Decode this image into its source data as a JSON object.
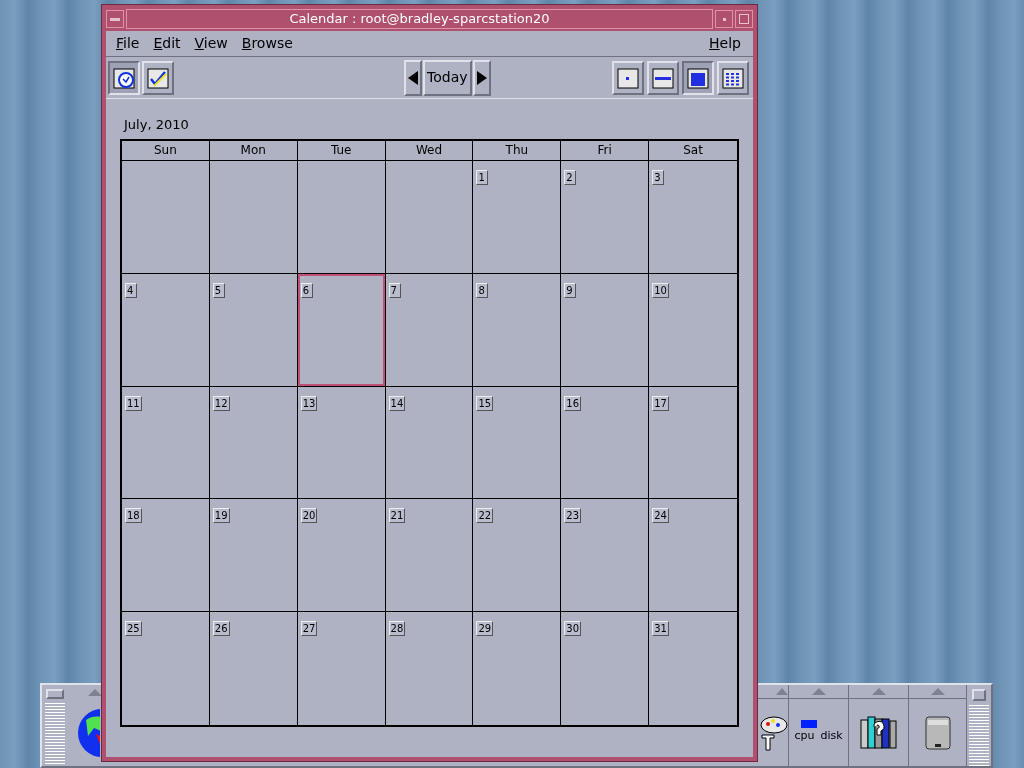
{
  "window": {
    "title": "Calendar : root@bradley-sparcstation20"
  },
  "menu": [
    {
      "label": "File"
    },
    {
      "label": "Edit"
    },
    {
      "label": "View"
    },
    {
      "label": "Browse"
    },
    {
      "label": "Help"
    }
  ],
  "toolbar": {
    "left": [
      {
        "kind": "appointment",
        "selected": true
      },
      {
        "kind": "todo",
        "selected": false
      }
    ],
    "today": "Today",
    "views": [
      {
        "kind": "day",
        "selected": false
      },
      {
        "kind": "week",
        "selected": false
      },
      {
        "kind": "month",
        "selected": true
      },
      {
        "kind": "year",
        "selected": false
      }
    ]
  },
  "calendar": {
    "month_label": "July, 2010",
    "weekdays": [
      "Sun",
      "Mon",
      "Tue",
      "Wed",
      "Thu",
      "Fri",
      "Sat"
    ],
    "weeks": [
      [
        {
          "kind": "empty"
        },
        {
          "kind": "empty"
        },
        {
          "kind": "empty"
        },
        {
          "kind": "empty"
        },
        {
          "kind": "day",
          "day": "1",
          "selected": false
        },
        {
          "kind": "day",
          "day": "2",
          "selected": false
        },
        {
          "kind": "day",
          "day": "3",
          "selected": false
        }
      ],
      [
        {
          "kind": "day",
          "day": "4",
          "selected": false
        },
        {
          "kind": "day",
          "day": "5",
          "selected": false
        },
        {
          "kind": "day",
          "day": "6",
          "selected": true
        },
        {
          "kind": "day",
          "day": "7",
          "selected": false
        },
        {
          "kind": "day",
          "day": "8",
          "selected": false
        },
        {
          "kind": "day",
          "day": "9",
          "selected": false
        },
        {
          "kind": "day",
          "day": "10",
          "selected": false
        }
      ],
      [
        {
          "kind": "day",
          "day": "11",
          "selected": false
        },
        {
          "kind": "day",
          "day": "12",
          "selected": false
        },
        {
          "kind": "day",
          "day": "13",
          "selected": false
        },
        {
          "kind": "day",
          "day": "14",
          "selected": false
        },
        {
          "kind": "day",
          "day": "15",
          "selected": false
        },
        {
          "kind": "day",
          "day": "16",
          "selected": false
        },
        {
          "kind": "day",
          "day": "17",
          "selected": false
        }
      ],
      [
        {
          "kind": "day",
          "day": "18",
          "selected": false
        },
        {
          "kind": "day",
          "day": "19",
          "selected": false
        },
        {
          "kind": "day",
          "day": "20",
          "selected": false
        },
        {
          "kind": "day",
          "day": "21",
          "selected": false
        },
        {
          "kind": "day",
          "day": "22",
          "selected": false
        },
        {
          "kind": "day",
          "day": "23",
          "selected": false
        },
        {
          "kind": "day",
          "day": "24",
          "selected": false
        }
      ],
      [
        {
          "kind": "day",
          "day": "25",
          "selected": false
        },
        {
          "kind": "day",
          "day": "26",
          "selected": false
        },
        {
          "kind": "day",
          "day": "27",
          "selected": false
        },
        {
          "kind": "day",
          "day": "28",
          "selected": false
        },
        {
          "kind": "day",
          "day": "29",
          "selected": false
        },
        {
          "kind": "day",
          "day": "30",
          "selected": false
        },
        {
          "kind": "day",
          "day": "31",
          "selected": false
        }
      ]
    ]
  },
  "front_panel": {
    "meter_labels": [
      "cpu",
      "disk"
    ]
  }
}
